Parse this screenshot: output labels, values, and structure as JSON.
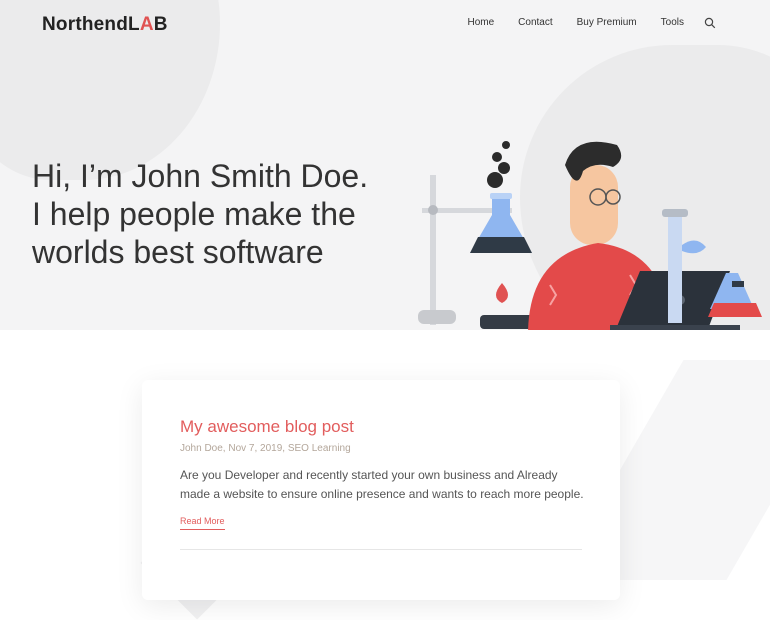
{
  "header": {
    "logo_text": "NorthendL",
    "logo_accent": "A",
    "logo_tail": "B",
    "nav": [
      "Home",
      "Contact",
      "Buy Premium",
      "Tools"
    ]
  },
  "hero": {
    "lines": [
      "Hi, I’m John Smith Doe.",
      "I help people make the",
      "worlds best software"
    ]
  },
  "post": {
    "title": "My awesome blog post",
    "meta": "John Doe, Nov 7, 2019, SEO Learning",
    "excerpt": "Are you Developer and recently started your own business and Already made a website to ensure online presence and wants to reach more people.",
    "read_more": "Read More"
  },
  "colors": {
    "accent": "#e25d5d",
    "hero_bg": "#f4f4f5",
    "meta": "#b3a69a"
  },
  "icons": [
    "search-icon"
  ]
}
